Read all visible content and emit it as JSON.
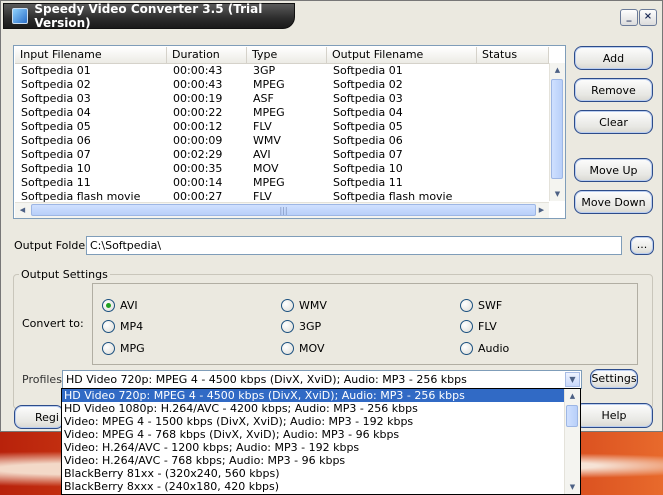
{
  "window": {
    "title": "Speedy Video Converter 3.5 (Trial Version)",
    "minimize_label": "_",
    "close_label": "×"
  },
  "file_table": {
    "columns": [
      "Input Filename",
      "Duration",
      "Type",
      "Output Filename",
      "Status"
    ],
    "rows": [
      [
        "Softpedia 01",
        "00:00:43",
        "3GP",
        "Softpedia 01",
        ""
      ],
      [
        "Softpedia 02",
        "00:00:43",
        "MPEG",
        "Softpedia 02",
        ""
      ],
      [
        "Softpedia 03",
        "00:00:19",
        "ASF",
        "Softpedia 03",
        ""
      ],
      [
        "Softpedia 04",
        "00:00:22",
        "MPEG",
        "Softpedia 04",
        ""
      ],
      [
        "Softpedia 05",
        "00:00:12",
        "FLV",
        "Softpedia 05",
        ""
      ],
      [
        "Softpedia 06",
        "00:00:09",
        "WMV",
        "Softpedia 06",
        ""
      ],
      [
        "Softpedia 07",
        "00:02:29",
        "AVI",
        "Softpedia 07",
        ""
      ],
      [
        "Softpedia 10",
        "00:00:35",
        "MOV",
        "Softpedia 10",
        ""
      ],
      [
        "Softpedia 11",
        "00:00:14",
        "MPEG",
        "Softpedia 11",
        ""
      ],
      [
        "Softpedia flash movie",
        "00:00:27",
        "FLV",
        "Softpedia flash movie",
        ""
      ]
    ]
  },
  "side_buttons": {
    "add": "Add",
    "remove": "Remove",
    "clear": "Clear",
    "move_up": "Move Up",
    "move_down": "Move Down"
  },
  "output_folder": {
    "label": "Output Folder:",
    "value": "C:\\Softpedia\\",
    "browse": "..."
  },
  "output_settings": {
    "title": "Output Settings",
    "convert_label": "Convert to:",
    "formats": [
      {
        "label": "AVI",
        "selected": true
      },
      {
        "label": "WMV",
        "selected": false
      },
      {
        "label": "SWF",
        "selected": false
      },
      {
        "label": "MP4",
        "selected": false
      },
      {
        "label": "3GP",
        "selected": false
      },
      {
        "label": "FLV",
        "selected": false
      },
      {
        "label": "MPG",
        "selected": false
      },
      {
        "label": "MOV",
        "selected": false
      },
      {
        "label": "Audio",
        "selected": false
      }
    ],
    "profiles_label": "Profiles:",
    "profile_selected": "HD Video 720p: MPEG 4 - 4500 kbps (DivX, XviD); Audio: MP3 - 256 kbps",
    "settings_button": "Settings",
    "profile_options": [
      "HD Video 720p: MPEG 4 - 4500 kbps (DivX, XviD); Audio: MP3 - 256 kbps",
      "HD Video 1080p: H.264/AVC - 4200 kbps; Audio: MP3 - 256 kbps",
      "Video: MPEG 4 - 1500 kbps (DivX, XviD); Audio: MP3 - 192 kbps",
      "Video: MPEG 4 - 768 kbps (DivX, XviD); Audio: MP3 - 96 kbps",
      "Video: H.264/AVC - 1200 kbps; Audio: MP3 - 192 kbps",
      "Video: H.264/AVC - 768 kbps; Audio: MP3 - 96 kbps",
      "BlackBerry 81xx - (320x240, 560 kbps)",
      "BlackBerry 8xxx - (240x180, 420 kbps)"
    ]
  },
  "bottom_buttons": {
    "register": "Regi",
    "help": "Help"
  },
  "colors": {
    "selection": "#316ac5",
    "radio_on": "#21a121",
    "button_border": "#2d4c8a"
  }
}
